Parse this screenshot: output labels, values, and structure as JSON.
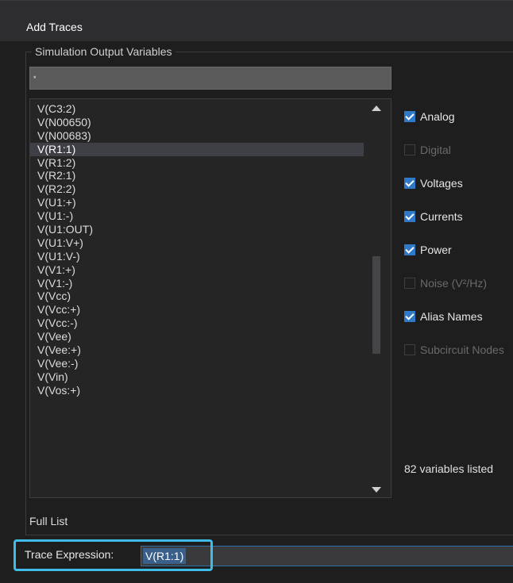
{
  "window": {
    "title": "Add Traces"
  },
  "group": {
    "legend": "Simulation Output Variables"
  },
  "filter": {
    "value": "*"
  },
  "variables": [
    {
      "label": "V(C3:2)",
      "selected": false
    },
    {
      "label": "V(N00650)",
      "selected": false
    },
    {
      "label": "V(N00683)",
      "selected": false
    },
    {
      "label": "V(R1:1)",
      "selected": true
    },
    {
      "label": "V(R1:2)",
      "selected": false
    },
    {
      "label": "V(R2:1)",
      "selected": false
    },
    {
      "label": "V(R2:2)",
      "selected": false
    },
    {
      "label": "V(U1:+)",
      "selected": false
    },
    {
      "label": "V(U1:-)",
      "selected": false
    },
    {
      "label": "V(U1:OUT)",
      "selected": false
    },
    {
      "label": "V(U1:V+)",
      "selected": false
    },
    {
      "label": "V(U1:V-)",
      "selected": false
    },
    {
      "label": "V(V1:+)",
      "selected": false
    },
    {
      "label": "V(V1:-)",
      "selected": false
    },
    {
      "label": "V(Vcc)",
      "selected": false
    },
    {
      "label": "V(Vcc:+)",
      "selected": false
    },
    {
      "label": "V(Vcc:-)",
      "selected": false
    },
    {
      "label": "V(Vee)",
      "selected": false
    },
    {
      "label": "V(Vee:+)",
      "selected": false
    },
    {
      "label": "V(Vee:-)",
      "selected": false
    },
    {
      "label": "V(Vin)",
      "selected": false
    },
    {
      "label": "V(Vos:+)",
      "selected": false
    }
  ],
  "filters": [
    {
      "label": "Analog",
      "checked": true,
      "enabled": true
    },
    {
      "label": "Digital",
      "checked": false,
      "enabled": false
    },
    {
      "label": "Voltages",
      "checked": true,
      "enabled": true
    },
    {
      "label": "Currents",
      "checked": true,
      "enabled": true
    },
    {
      "label": "Power",
      "checked": true,
      "enabled": true
    },
    {
      "label": "Noise (V²/Hz)",
      "checked": false,
      "enabled": false
    },
    {
      "label": "Alias Names",
      "checked": true,
      "enabled": true
    },
    {
      "label": "Subcircuit Nodes",
      "checked": false,
      "enabled": false
    }
  ],
  "status": {
    "count_text": "82 variables listed"
  },
  "footer": {
    "full_list_label": "Full List"
  },
  "trace": {
    "label": "Trace Expression:",
    "value": "V(R1:1)"
  },
  "colors": {
    "accent": "#3fbde8",
    "checkbox": "#2f79c8",
    "selection": "#3f3f46"
  }
}
